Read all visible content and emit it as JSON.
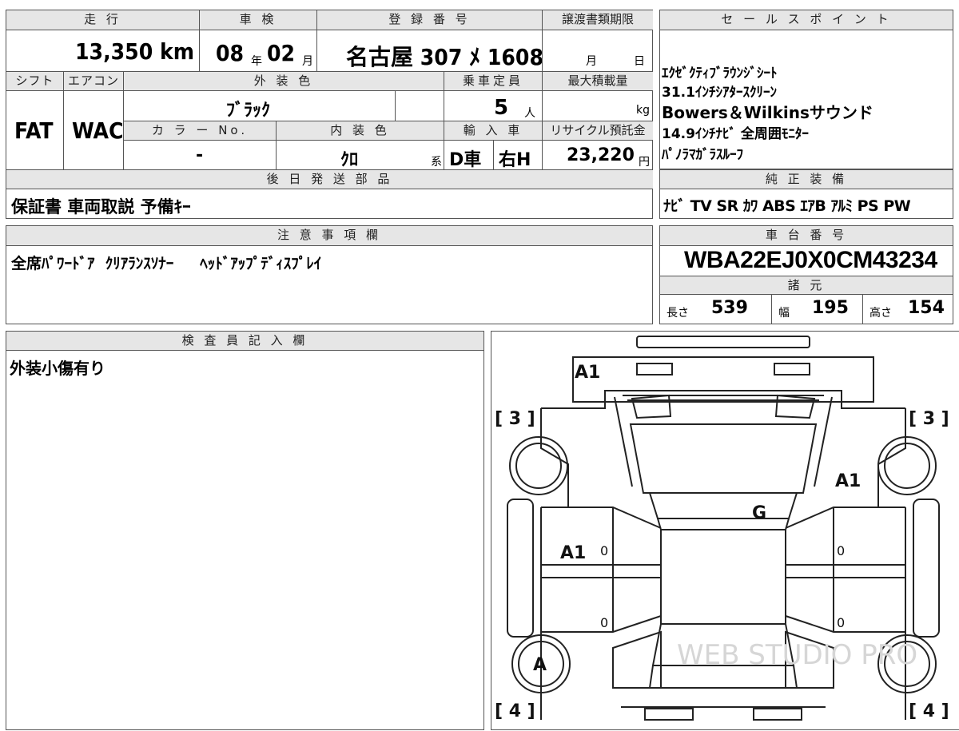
{
  "top_table": {
    "mileage_header": "走 行",
    "mileage_value": "13,350 km",
    "inspection_header": "車 検",
    "inspection_year": "08",
    "inspection_year_unit": "年",
    "inspection_month": "02",
    "inspection_month_unit": "月",
    "registration_header": "登 録 番 号",
    "registration_value": "名古屋 307 ﾒ 1608",
    "transfer_header": "譲渡書類期限",
    "transfer_month_unit": "月",
    "transfer_day_unit": "日",
    "shift_header": "シフト",
    "shift_value": "FAT",
    "aircon_header": "エアコン",
    "aircon_value": "WAC",
    "exterior_color_header": "外 装 色",
    "exterior_color_value": "ﾌﾞﾗｯｸ",
    "capacity_header": "乗車定員",
    "capacity_value": "5",
    "capacity_unit": "人",
    "max_load_header": "最大積載量",
    "max_load_unit": "kg",
    "color_no_header": "カ ラ ー No.",
    "color_no_value": "-",
    "interior_color_header": "内 装 色",
    "interior_color_value": "ｸﾛ",
    "interior_color_suffix": "系",
    "import_header": "輸 入 車",
    "import_value": "D車",
    "steering_value": "右H",
    "recycle_header": "リサイクル預託金",
    "recycle_value": "23,220",
    "recycle_unit": "円",
    "later_parts_header": "後 日 発 送 部 品",
    "later_parts_value": "保証書 車両取説 予備ｷｰ"
  },
  "sales_points": {
    "header": "セ ー ル ス ポ イ ン ト",
    "lines": [
      "ｴｸｾﾞｸﾃｨﾌﾞﾗｳﾝｼﾞｼｰﾄ",
      "31.1ｲﾝﾁｼｱﾀｰｽｸﾘｰﾝ",
      "Bowers＆Wilkinsサウンド",
      "14.9ｲﾝﾁﾅﾋﾞ  全周囲ﾓﾆﾀｰ",
      "ﾊﾟﾉﾗﾏｶﾞﾗｽﾙｰﾌ"
    ]
  },
  "equipment": {
    "header": "純 正 装 備",
    "value": "ﾅﾋﾞ TV SR ｶﾜ ABS ｴｱB ｱﾙﾐ PS PW"
  },
  "notes": {
    "header": "注 意 事 項 欄",
    "value": "全席ﾊﾟﾜｰﾄﾞｱ  ｸﾘｱﾗﾝｽｿﾅｰ     ﾍｯﾄﾞｱｯﾌﾟﾃﾞｨｽﾌﾟﾚｲ"
  },
  "chassis": {
    "header": "車 台 番 号",
    "value": "WBA22EJ0X0CM43234",
    "spec_header": "諸 元",
    "length_label": "長さ",
    "length_value": "539",
    "width_label": "幅",
    "width_value": "195",
    "height_label": "高さ",
    "height_value": "154"
  },
  "inspector": {
    "header": "検 査 員 記 入 欄",
    "comment": "外装小傷有り"
  },
  "diagram": {
    "watermark": "WEB STUDIO PRO",
    "marks": {
      "front_bumper": "A1",
      "left_front_bracket": "[ 3 ]",
      "right_front_bracket": "[ 3 ]",
      "left_rear_bracket": "[ 4 ]",
      "right_rear_bracket": "[ 4 ]",
      "right_front_fender": "A1",
      "roof": "G",
      "left_front_door": "A1",
      "left_rear_wheel": "A",
      "door_zero_lf": "0",
      "door_zero_rf": "0",
      "door_zero_lr": "0",
      "door_zero_rr": "0"
    }
  }
}
